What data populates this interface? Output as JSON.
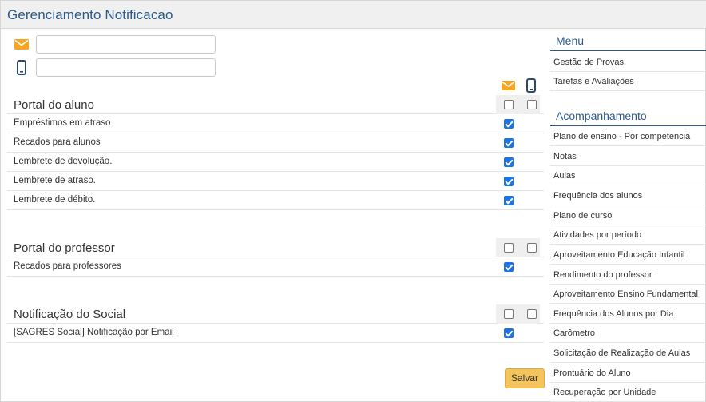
{
  "window": {
    "title": "Gerenciamento Notificacao"
  },
  "contacts": {
    "email_value": "",
    "phone_value": ""
  },
  "colors": {
    "accent": "#f5a623",
    "brand": "#2b5a8a",
    "button": "#f5c45c",
    "check": "#1a73e8"
  },
  "sections": [
    {
      "title": "Portal do aluno",
      "items": [
        {
          "label": "Empréstimos em atraso",
          "email": true
        },
        {
          "label": "Recados para alunos",
          "email": true
        },
        {
          "label": "Lembrete de devolução.",
          "email": true
        },
        {
          "label": "Lembrete de atraso.",
          "email": true
        },
        {
          "label": "Lembrete de débito.",
          "email": true
        }
      ]
    },
    {
      "title": "Portal do professor",
      "items": [
        {
          "label": "Recados para professores",
          "email": true
        }
      ]
    },
    {
      "title": "Notificação do Social",
      "items": [
        {
          "label": "[SAGRES Social] Notificação por Email",
          "email": true
        }
      ]
    }
  ],
  "actions": {
    "save_label": "Salvar"
  },
  "sidebar": {
    "menu": {
      "title": "Menu",
      "items": [
        "Gestão de Provas",
        "Tarefas e Avaliações"
      ]
    },
    "acompanhamento": {
      "title": "Acompanhamento",
      "items": [
        "Plano de ensino - Por competencia",
        "Notas",
        "Aulas",
        "Frequência dos alunos",
        "Plano de curso",
        "Atividades por período",
        "Aproveitamento Educação Infantil",
        "Rendimento do professor",
        "Aproveitamento Ensino Fundamental",
        "Frequência dos Alunos por Dia",
        "Carômetro",
        "Solicitação de Realização de Aulas",
        "Prontuário do Aluno",
        "Recuperação por Unidade"
      ]
    }
  }
}
